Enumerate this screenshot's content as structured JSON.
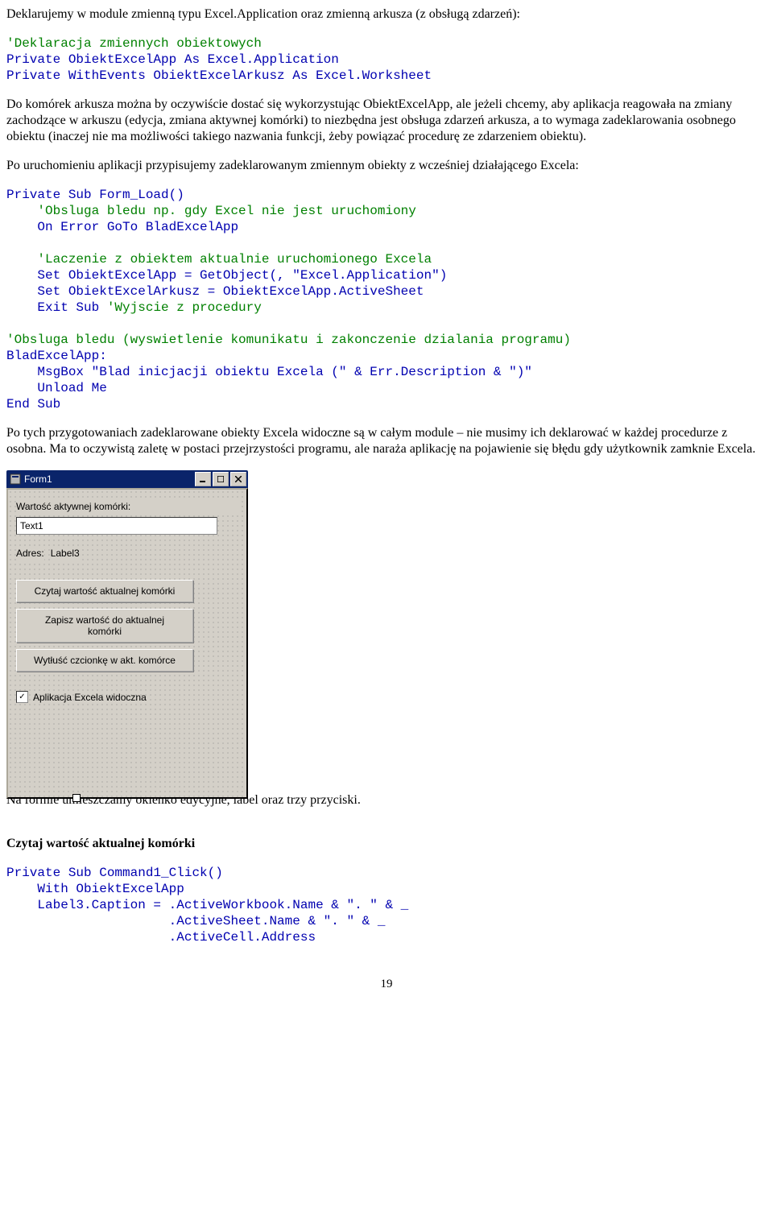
{
  "para1": "Deklarujemy w module zmienną typu Excel.Application oraz zmienną arkusza (z obsługą zdarzeń):",
  "code1_c1": "'Deklaracja zmiennych obiektowych",
  "code1_l2": "Private ObiektExcelApp As Excel.Application",
  "code1_l3": "Private WithEvents ObiektExcelArkusz As Excel.Worksheet",
  "para2": "Do komórek arkusza można by oczywiście dostać się wykorzystując ObiektExcelApp, ale jeżeli chcemy, aby aplikacja reagowała na zmiany zachodzące w arkuszu (edycja, zmiana aktywnej komórki) to niezbędna jest obsługa zdarzeń arkusza, a to wymaga zadeklarowania osobnego obiektu (inaczej nie ma możliwości takiego nazwania funkcji, żeby powiązać procedurę ze zdarzeniem obiektu).",
  "para3": "Po uruchomieniu aplikacji przypisujemy zadeklarowanym zmiennym obiekty z wcześniej działającego Excela:",
  "code2_l1": "Private Sub Form_Load()",
  "code2_c1": "    'Obsluga bledu np. gdy Excel nie jest uruchomiony",
  "code2_l3": "    On Error GoTo BladExcelApp",
  "code2_c2": "    'Laczenie z obiektem aktualnie uruchomionego Excela",
  "code2_l5": "    Set ObiektExcelApp = GetObject(, \"Excel.Application\")",
  "code2_l6": "    Set ObiektExcelArkusz = ObiektExcelApp.ActiveSheet",
  "code2_l7": "    Exit Sub ",
  "code2_c3": "'Wyjscie z procedury",
  "code2_c4": "'Obsluga bledu (wyswietlenie komunikatu i zakonczenie dzialania programu)",
  "code2_l9": "BladExcelApp:",
  "code2_l10": "    MsgBox \"Blad inicjacji obiektu Excela (\" & Err.Description & \")\"",
  "code2_l11": "    Unload Me",
  "code2_l12": "End Sub",
  "para4": "Po tych przygotowaniach zadeklarowane obiekty Excela widoczne są w całym module – nie musimy ich deklarować w każdej procedurze z osobna. Ma to oczywistą zaletę w postaci przejrzystości programu, ale naraża aplikację na pojawienie się błędu gdy użytkownik zamknie Excela.",
  "form": {
    "title": "Form1",
    "label1": "Wartość aktywnej komórki:",
    "textValue": "Text1",
    "addrLabel": "Adres:",
    "addrValue": "Label3",
    "btn1": "Czytaj wartość aktualnej komórki",
    "btn2": "Zapisz wartość do aktualnej komórki",
    "btn3": "Wytłuść czcionkę w akt. komórce",
    "checkLabel": "Aplikacja Excela widoczna",
    "checked": true
  },
  "para5": "Na formie umieszczamy okienko edycyjne, label oraz trzy przyciski.",
  "heading1": "Czytaj wartość aktualnej komórki",
  "code3_l1": "Private Sub Command1_Click()",
  "code3_l2": "    With ObiektExcelApp",
  "code3_l3": "    Label3.Caption = .ActiveWorkbook.Name & \". \" & _",
  "code3_l4": "                     .ActiveSheet.Name & \". \" & _",
  "code3_l5": "                     .ActiveCell.Address",
  "pageNum": "19"
}
